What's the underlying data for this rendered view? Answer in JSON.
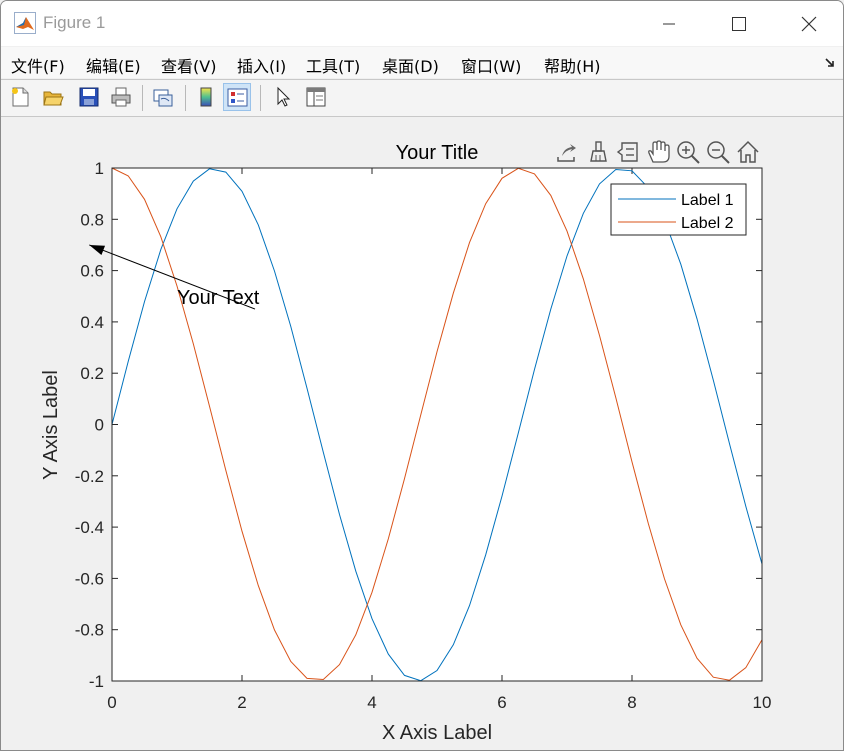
{
  "window": {
    "title": "Figure 1"
  },
  "menu": {
    "items": [
      {
        "label": "文件(F)"
      },
      {
        "label": "编辑(E)"
      },
      {
        "label": "查看(V)"
      },
      {
        "label": "插入(I)"
      },
      {
        "label": "工具(T)"
      },
      {
        "label": "桌面(D)"
      },
      {
        "label": "窗口(W)"
      },
      {
        "label": "帮助(H)"
      }
    ]
  },
  "toolbar": {
    "buttons": [
      {
        "icon": "new-figure-icon"
      },
      {
        "icon": "open-file-icon"
      },
      {
        "icon": "save-icon"
      },
      {
        "icon": "print-icon"
      },
      {
        "icon": "link-plot-icon"
      },
      {
        "icon": "colorbar-icon"
      },
      {
        "icon": "legend-icon",
        "active": true
      },
      {
        "icon": "edit-plot-pointer-icon"
      },
      {
        "icon": "property-inspector-icon"
      }
    ]
  },
  "axes_toolbar": {
    "buttons": [
      {
        "icon": "export-icon"
      },
      {
        "icon": "brush-icon"
      },
      {
        "icon": "data-tips-icon"
      },
      {
        "icon": "pan-hand-icon"
      },
      {
        "icon": "zoom-in-icon"
      },
      {
        "icon": "zoom-out-icon"
      },
      {
        "icon": "restore-view-home-icon"
      }
    ]
  },
  "chart_data": {
    "type": "line",
    "title": "Your Title",
    "xlabel": "X Axis Label",
    "ylabel": "Y Axis Label",
    "xlim": [
      0,
      10
    ],
    "ylim": [
      -1,
      1
    ],
    "xticks": [
      "0",
      "2",
      "4",
      "6",
      "8",
      "10"
    ],
    "yticks": [
      "-1",
      "-0.8",
      "-0.6",
      "-0.4",
      "-0.2",
      "0",
      "0.2",
      "0.4",
      "0.6",
      "0.8",
      "1"
    ],
    "grid": false,
    "legend_location": "top-right",
    "series": [
      {
        "name": "Label 1",
        "color": "#0072BD",
        "x": [
          0,
          0.25,
          0.5,
          0.75,
          1,
          1.25,
          1.5,
          1.75,
          2,
          2.25,
          2.5,
          2.75,
          3,
          3.25,
          3.5,
          3.75,
          4,
          4.25,
          4.5,
          4.75,
          5,
          5.25,
          5.5,
          5.75,
          6,
          6.25,
          6.5,
          6.75,
          7,
          7.25,
          7.5,
          7.75,
          8,
          8.25,
          8.5,
          8.75,
          9,
          9.25,
          9.5,
          9.75,
          10
        ],
        "values": [
          0,
          0.247,
          0.479,
          0.682,
          0.841,
          0.949,
          0.997,
          0.984,
          0.909,
          0.778,
          0.598,
          0.382,
          0.141,
          -0.108,
          -0.351,
          -0.572,
          -0.757,
          -0.895,
          -0.978,
          -0.999,
          -0.959,
          -0.859,
          -0.706,
          -0.508,
          -0.279,
          -0.033,
          0.215,
          0.45,
          0.657,
          0.823,
          0.938,
          0.994,
          0.989,
          0.923,
          0.798,
          0.625,
          0.412,
          0.173,
          -0.075,
          -0.319,
          -0.544
        ]
      },
      {
        "name": "Label 2",
        "color": "#D95319",
        "x": [
          0,
          0.25,
          0.5,
          0.75,
          1,
          1.25,
          1.5,
          1.75,
          2,
          2.25,
          2.5,
          2.75,
          3,
          3.25,
          3.5,
          3.75,
          4,
          4.25,
          4.5,
          4.75,
          5,
          5.25,
          5.5,
          5.75,
          6,
          6.25,
          6.5,
          6.75,
          7,
          7.25,
          7.5,
          7.75,
          8,
          8.25,
          8.5,
          8.75,
          9,
          9.25,
          9.5,
          9.75,
          10
        ],
        "values": [
          1,
          0.969,
          0.878,
          0.732,
          0.54,
          0.315,
          0.071,
          -0.178,
          -0.416,
          -0.628,
          -0.801,
          -0.924,
          -0.99,
          -0.994,
          -0.936,
          -0.82,
          -0.654,
          -0.446,
          -0.211,
          0.038,
          0.284,
          0.512,
          0.709,
          0.861,
          0.96,
          0.999,
          0.977,
          0.893,
          0.754,
          0.568,
          0.347,
          0.105,
          -0.146,
          -0.386,
          -0.602,
          -0.781,
          -0.911,
          -0.985,
          -0.997,
          -0.948,
          -0.839
        ]
      }
    ],
    "annotation": {
      "text": "Your Text",
      "arrow_from": [
        2.2,
        0.45
      ],
      "arrow_to": [
        -0.35,
        0.7
      ]
    }
  }
}
